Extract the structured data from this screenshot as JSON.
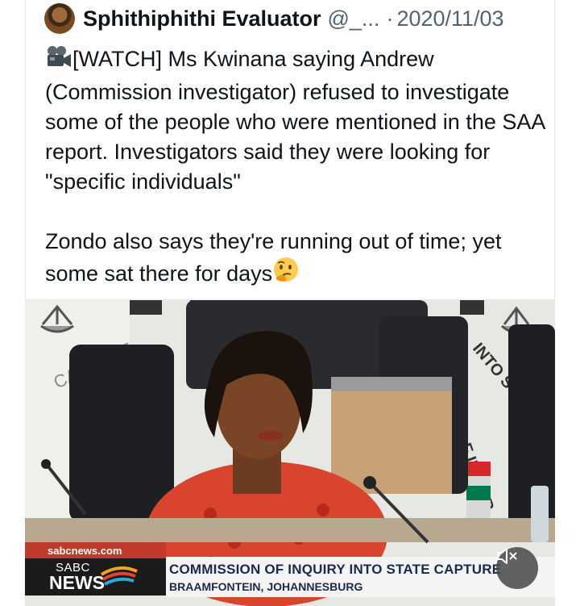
{
  "tweet": {
    "author_name": "Sphithiphithi Evaluator",
    "handle": "@_...",
    "separator": "·",
    "date": "2020/11/03",
    "text_line1": "[WATCH] Ms Kwinana saying Andrew (Commission investigator) refused to investigate some of the people who were mentioned in the SAA report. Investigators said they were looking for \"specific individuals\"",
    "text_line2": "Zondo also says they're running out of time; yet some sat there for days",
    "emoji_start": "movie-camera-icon",
    "emoji_end": "thinking-face-icon"
  },
  "media": {
    "channel_site": "sabcnews.com",
    "logo_top": "SABC",
    "logo_bottom": "NEWS",
    "chyron_title": "COMMISSION OF INQUIRY INTO STATE CAPTURE",
    "chyron_subtitle": "BRAAMFONTEIN, JOHANNESBURG",
    "backdrop_text_left": "CAPTURE",
    "backdrop_text_right_top": "INTO ST",
    "backdrop_text_right_bottom": "F INQUIR",
    "mute_icon": "speaker-muted-icon"
  }
}
